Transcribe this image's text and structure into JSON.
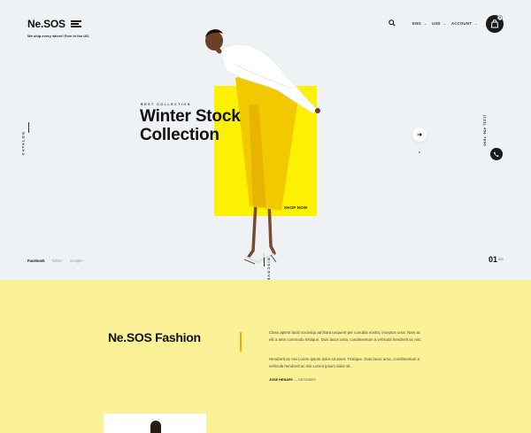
{
  "header": {
    "logo": "Ne.SOS",
    "tagline": "We ship every where! Free in the US.",
    "nav": [
      {
        "label": "ENG"
      },
      {
        "label": "USD"
      },
      {
        "label": "ACCOUNT"
      }
    ],
    "cart_count": "0"
  },
  "side": {
    "catalog_label": "CATALOG",
    "phone": "(123) 456 7890"
  },
  "hero": {
    "eyebrow": "BEST COLLECTION",
    "headline_line1": "Winter Stock",
    "headline_line2": "Collection",
    "cta": "SHOP NOW",
    "discover": "DISCOVER NOW",
    "slide_current": "01",
    "slide_total": "/03"
  },
  "social": [
    {
      "label": "Facebook",
      "active": true
    },
    {
      "label": "Twitter",
      "active": false
    },
    {
      "label": "Google+",
      "active": false
    }
  ],
  "about": {
    "heading": "Ne.SOS Fashion",
    "paragraph1": "Class aptent taciti sociosqu ad litora torquent per conubia nostra, inceptos uma. Nam ac elit a ante commodo tristique. Duis lacus urna, condimentum a vehicula hendrerit ac nisi.",
    "paragraph2": "Hendrerit ac nisi Lorem ipsum dolor sit amet. Tristique. Duis lacus urna, condimentum a vehicula hendrerit ac nisi Lorem ipsum dolor sit.",
    "author_name": "JOSE HENARY",
    "author_role": "— DESIGNER"
  },
  "colors": {
    "hero_bg": "#eef2f4",
    "yellow_panel": "#fcf100",
    "about_bg": "#fbf197",
    "accent_bar": "#f7a900"
  }
}
